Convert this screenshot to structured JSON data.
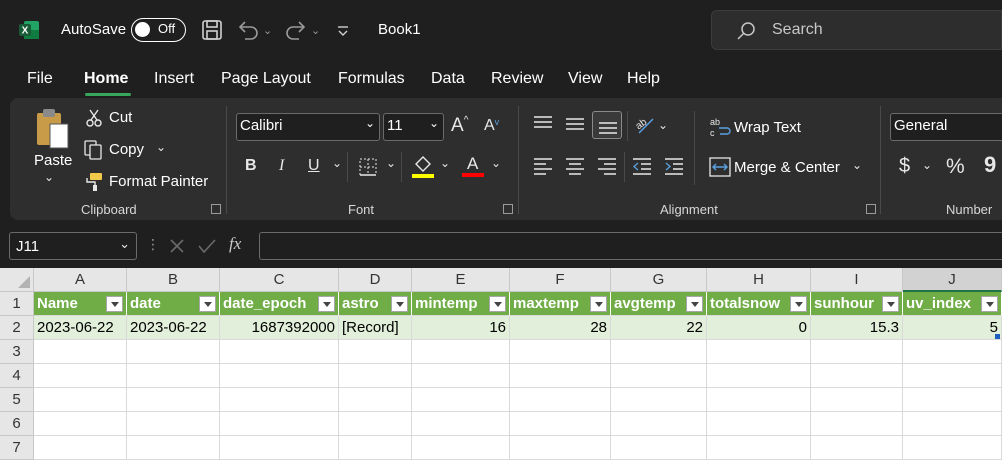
{
  "titlebar": {
    "autosave_label": "AutoSave",
    "autosave_state": "Off",
    "book_title": "Book1",
    "search_placeholder": "Search"
  },
  "menu_tabs": [
    "File",
    "Home",
    "Insert",
    "Page Layout",
    "Formulas",
    "Data",
    "Review",
    "View",
    "Help"
  ],
  "active_tab": "Home",
  "ribbon": {
    "clipboard": {
      "label": "Clipboard",
      "paste": "Paste",
      "cut": "Cut",
      "copy": "Copy",
      "format_painter": "Format Painter"
    },
    "font": {
      "label": "Font",
      "font_name": "Calibri",
      "font_size": "11",
      "bold": "B",
      "italic": "I",
      "underline": "U",
      "font_color_letter": "A",
      "grow_letter": "A",
      "shrink_letter": "A",
      "highlight_color": "#ffff00",
      "font_color": "#ff0000"
    },
    "alignment": {
      "label": "Alignment",
      "wrap_text": "Wrap Text",
      "merge_center": "Merge & Center"
    },
    "number": {
      "label": "Number",
      "format": "General",
      "currency": "$",
      "percent": "%",
      "comma": "9"
    }
  },
  "formula_bar": {
    "name_box": "J11",
    "fx": "fx",
    "value": ""
  },
  "grid": {
    "columns": [
      "A",
      "B",
      "C",
      "D",
      "E",
      "F",
      "G",
      "H",
      "I",
      "J"
    ],
    "selected_column": "J",
    "row_numbers": [
      "1",
      "2",
      "3",
      "4",
      "5",
      "6",
      "7"
    ],
    "header_row": [
      "Name",
      "date",
      "date_epoch",
      "astro",
      "mintemp",
      "maxtemp",
      "avgtemp",
      "totalsnow",
      "sunhour",
      "uv_index"
    ],
    "data_row": [
      "2023-06-22",
      "2023-06-22",
      "1687392000",
      "[Record]",
      "16",
      "28",
      "22",
      "0",
      "15.3",
      "5"
    ],
    "table_header_color": "#70ad47",
    "table_row_color": "#e2efda"
  }
}
